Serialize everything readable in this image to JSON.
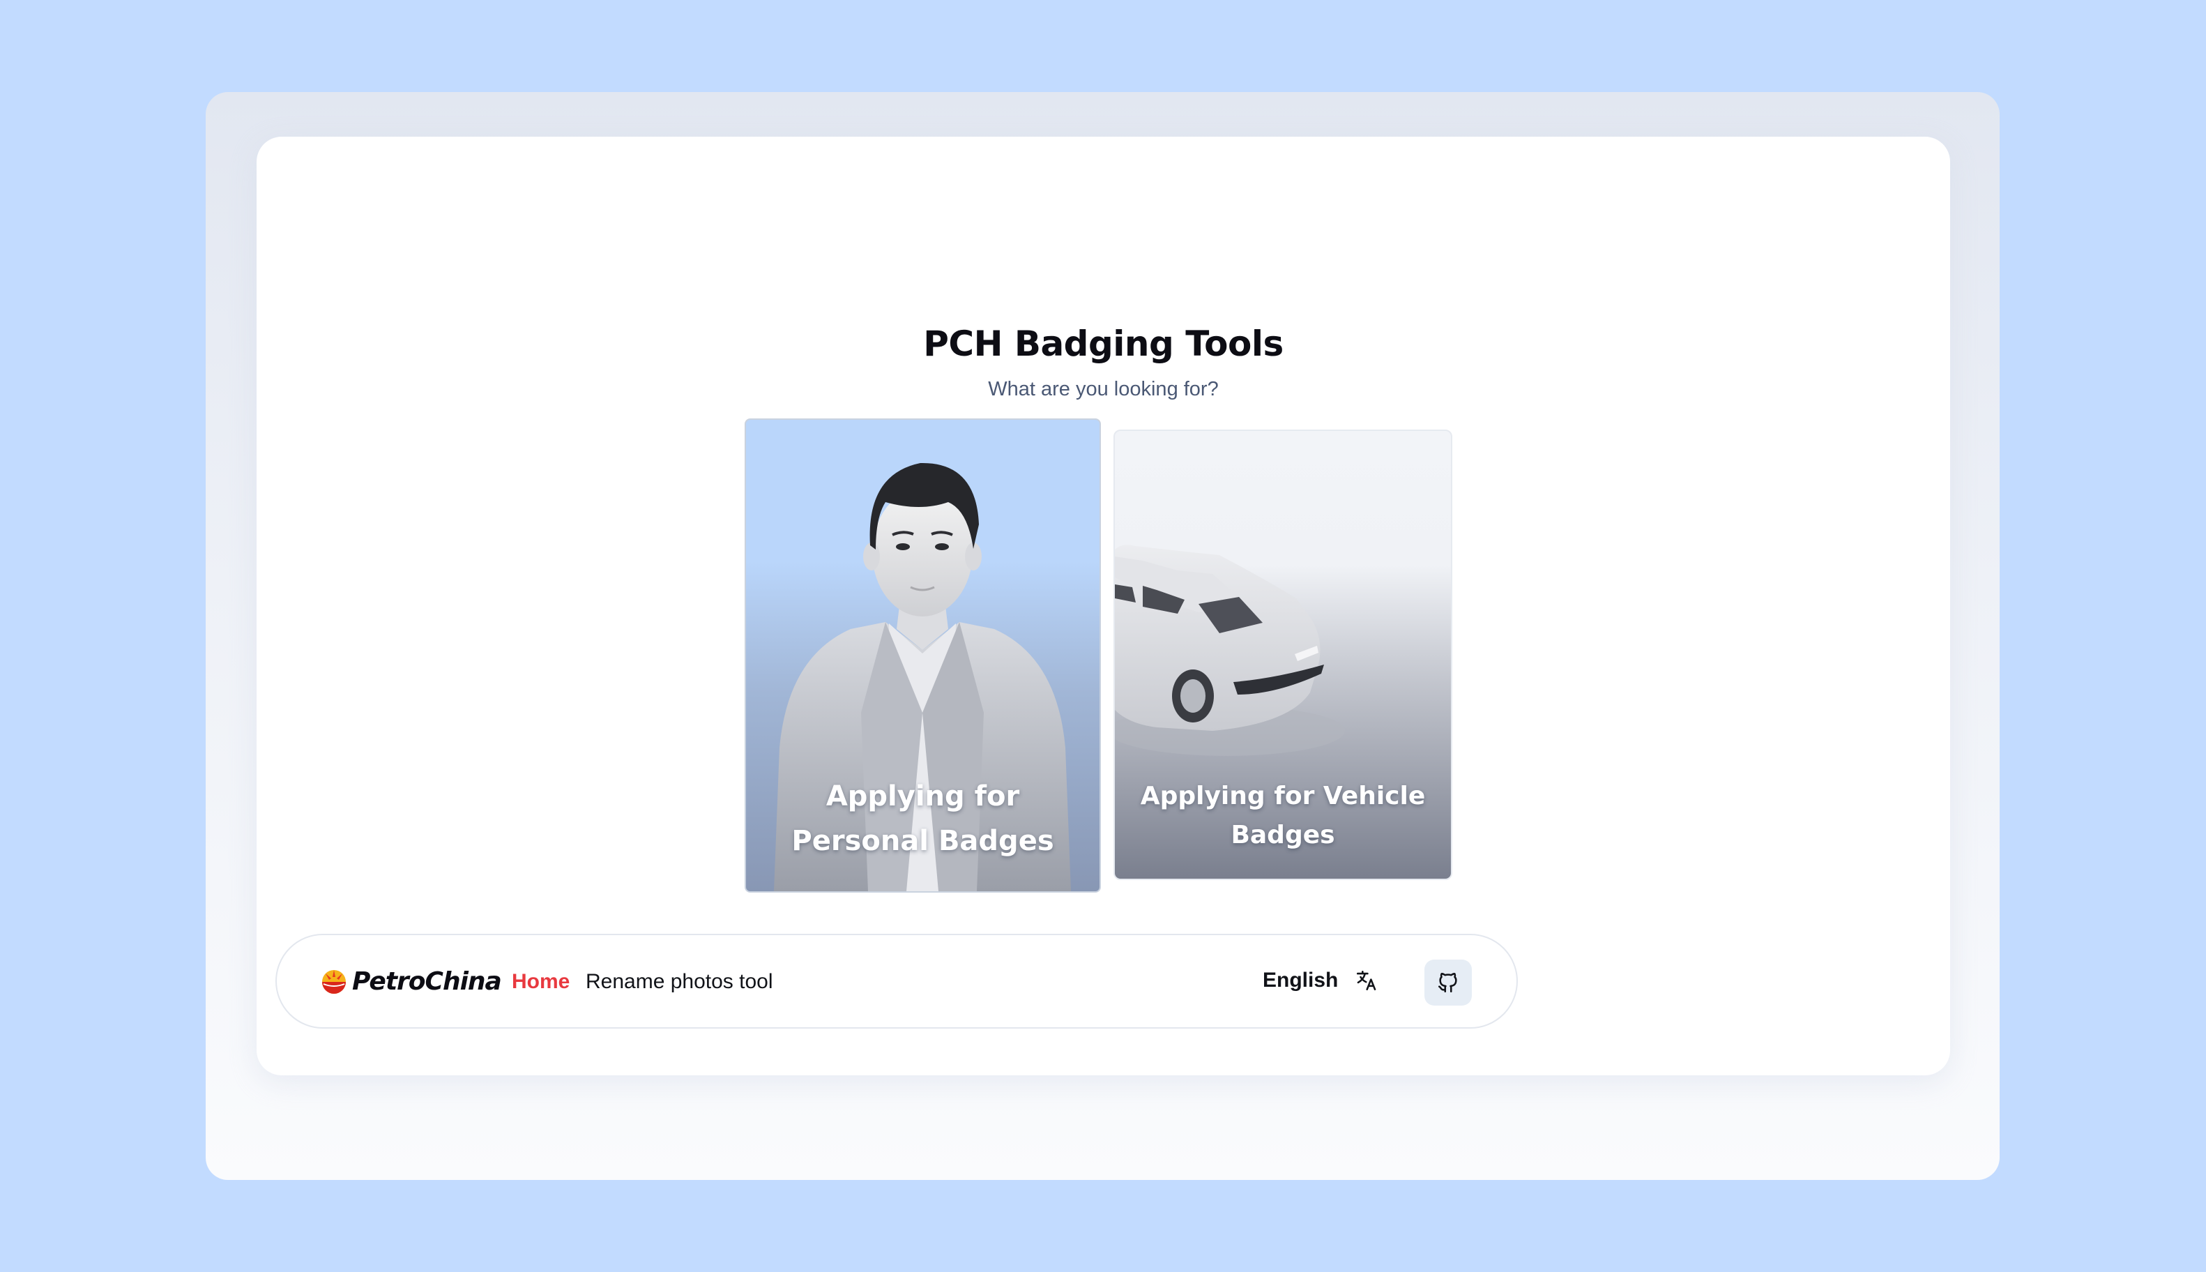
{
  "app": {
    "title": "PCH Badging Tools",
    "subtitle": "What are you looking for?"
  },
  "cards": [
    {
      "label": "Applying for Personal Badges",
      "image": "person-illustration"
    },
    {
      "label": "Applying for Vehicle Badges",
      "image": "car-illustration"
    }
  ],
  "navbar": {
    "brand": "PetroChina",
    "brand_logo": "petrochina-logo",
    "links": [
      {
        "label": "Home",
        "active": true
      },
      {
        "label": "Rename photos tool",
        "active": false
      }
    ],
    "language": "English",
    "language_icon": "translate-icon",
    "github_icon": "github-icon"
  },
  "colors": {
    "page_background": "#c2dbff",
    "active_link": "#e8393f",
    "personal_card": "#bad6fb",
    "github_button": "#e6edf5"
  }
}
